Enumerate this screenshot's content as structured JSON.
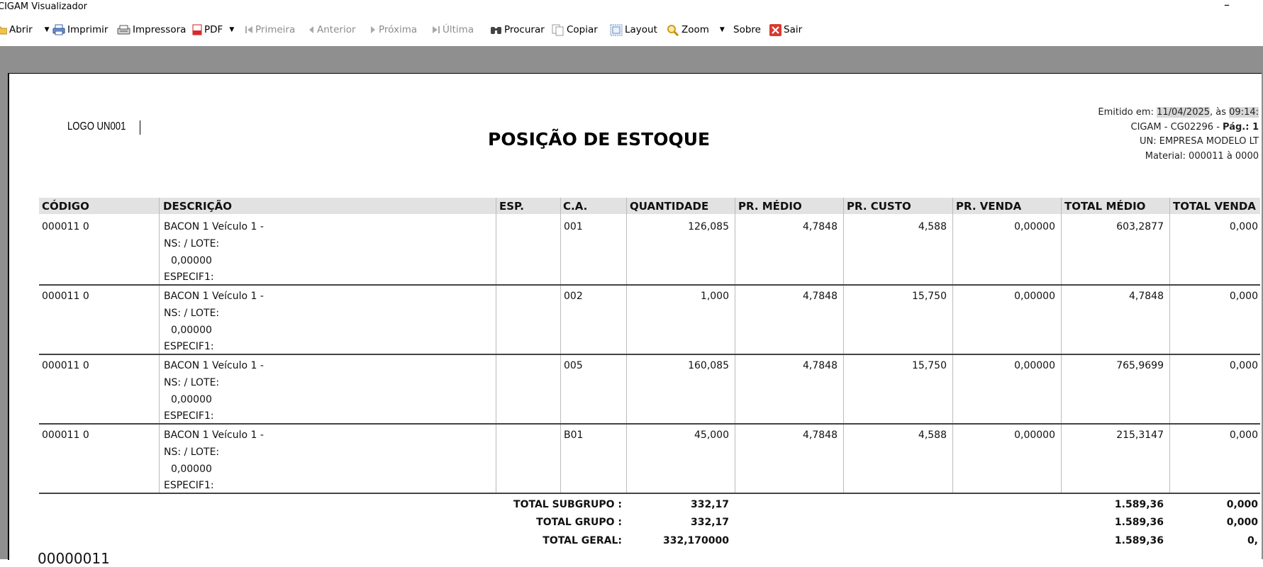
{
  "window": {
    "title": "CIGAM Visualizador",
    "minimize": "–"
  },
  "toolbar": {
    "abrir": "Abrir",
    "imprimir": "Imprimir",
    "impressora": "Impressora",
    "pdf": "PDF",
    "primeira": "Primeira",
    "anterior": "Anterior",
    "proxima": "Próxima",
    "ultima": "Última",
    "procurar": "Procurar",
    "copiar": "Copiar",
    "layout": "Layout",
    "zoom": "Zoom",
    "sobre": "Sobre",
    "sair": "Sair"
  },
  "report": {
    "logo": "LOGO UN001",
    "title": "POSIÇÃO DE ESTOQUE",
    "emitido_label": "Emitido em: ",
    "emitido_date": "11/04/2025",
    "emitido_sep": ", às ",
    "emitido_time": "09:14:",
    "system_line": "CIGAM - CG02296 - ",
    "page_label": "Pág.: 1",
    "un_line": "UN: EMPRESA MODELO LT",
    "material_line": "Material: 000011 à 0000"
  },
  "columns": [
    "CÓDIGO",
    "DESCRIÇÃO",
    "ESP.",
    "C.A.",
    "QUANTIDADE",
    "PR. MÉDIO",
    "PR. CUSTO",
    "PR. VENDA",
    "TOTAL MÉDIO",
    "TOTAL VENDA"
  ],
  "rows": [
    {
      "codigo": "000011 0",
      "desc1": "BACON 1  Veículo 1 -",
      "desc2": "NS:  / LOTE:",
      "desc3": "0,00000",
      "desc4": "ESPECIF1:",
      "ca": "001",
      "quantidade": "126,085",
      "pr_medio": "4,7848",
      "pr_custo": "4,588",
      "pr_venda": "0,00000",
      "total_medio": "603,2877",
      "total_venda": "0,000"
    },
    {
      "codigo": "000011 0",
      "desc1": "BACON 1  Veículo 1 -",
      "desc2": "NS:  / LOTE:",
      "desc3": "0,00000",
      "desc4": "ESPECIF1:",
      "ca": "002",
      "quantidade": "1,000",
      "pr_medio": "4,7848",
      "pr_custo": "15,750",
      "pr_venda": "0,00000",
      "total_medio": "4,7848",
      "total_venda": "0,000"
    },
    {
      "codigo": "000011 0",
      "desc1": "BACON 1  Veículo 1 -",
      "desc2": "NS:  / LOTE:",
      "desc3": "0,00000",
      "desc4": "ESPECIF1:",
      "ca": "005",
      "quantidade": "160,085",
      "pr_medio": "4,7848",
      "pr_custo": "15,750",
      "pr_venda": "0,00000",
      "total_medio": "765,9699",
      "total_venda": "0,000"
    },
    {
      "codigo": "000011 0",
      "desc1": "BACON 1  Veículo 1 -",
      "desc2": "NS:  / LOTE:",
      "desc3": "0,00000",
      "desc4": "ESPECIF1:",
      "ca": "B01",
      "quantidade": "45,000",
      "pr_medio": "4,7848",
      "pr_custo": "4,588",
      "pr_venda": "0,00000",
      "total_medio": "215,3147",
      "total_venda": "0,000"
    }
  ],
  "totals": [
    {
      "label": "TOTAL SUBGRUPO :",
      "quantidade": "332,17",
      "total_medio": "1.589,36",
      "total_venda": "0,000"
    },
    {
      "label": "TOTAL GRUPO :",
      "quantidade": "332,17",
      "total_medio": "1.589,36",
      "total_venda": "0,000"
    },
    {
      "label": "TOTAL GERAL:",
      "quantidade": "332,170000",
      "total_medio": "1.589,36",
      "total_venda": "0,"
    }
  ],
  "footer_code": "00000011"
}
